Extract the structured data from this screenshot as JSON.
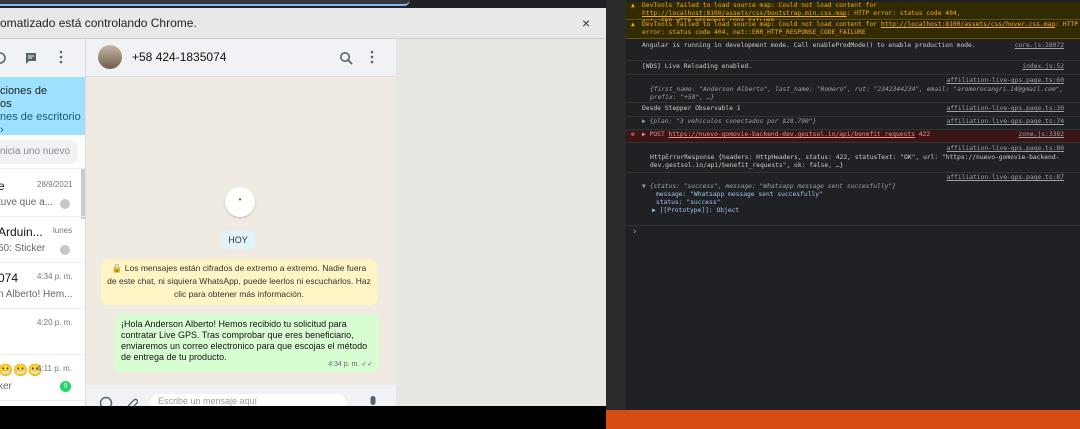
{
  "chrome": {
    "infobar_text": "omatizado está controlando Chrome.",
    "close_glyph": "×"
  },
  "sidebar": {
    "notification": {
      "line1": "ciones de",
      "line2": "os",
      "line3": "nes de escritorio ›"
    },
    "search_placeholder": "nicia uno nuevo",
    "chats": [
      {
        "name": "e",
        "preview": "tuve que a...",
        "time": "28/9/2021",
        "badge": ""
      },
      {
        "name": "Arduin...",
        "preview": "50: Sticker",
        "time": "lunes",
        "badge": ""
      },
      {
        "name": "074",
        "preview": "n Alberto! Hem...",
        "time": "4:34 p. m.",
        "badge": ""
      },
      {
        "name": "",
        "preview": "",
        "time": "4:20 p. m.",
        "badge": ""
      },
      {
        "name": "😬😬😬",
        "preview": "ker",
        "time": "4:11 p. m.",
        "badge": "9"
      }
    ]
  },
  "chat": {
    "contact": "+58 424-1835074",
    "day_label": "HOY",
    "encryption_notice": "🔒 Los mensajes están cifrados de extremo a extremo. Nadie fuera de este chat, ni siquiera WhatsApp, puede leerlos ni escucharlos. Haz clic para obtener más información.",
    "message_text": "¡Hola Anderson Alberto! Hemos recibido tu solicitud para contratar Live GPS. Tras comprobar que eres beneficiario, enviaremos un correo electronico para que escojas el método de entrega de tu producto.",
    "message_time": "4:34 p. m. ✓✓",
    "composer_placeholder": "Escribe un mensaje aquí"
  },
  "devtools": {
    "warn1": "DevTools failed to load source map: Could not load content for ",
    "warn1_link": "http://localhost:8100/assets/css/bootstrap.min.css.map",
    "warn1_tail": ": HTTP error: status code 404, net::ERR_HTTP_RESPONSE_CODE_FAILURE",
    "warn2": "DevTools failed to load source map: Could not load content for ",
    "warn2_link": "http://localhost:8100/assets/css/hover.css.map",
    "warn2_tail": ": HTTP error: status code 404, net::ERR_HTTP_RESPONSE_CODE_FAILURE",
    "angular": "Angular is running in development mode. Call enableProdMode() to enable production mode.",
    "angular_src": "core.js:28072",
    "wds": "[WDS] Live Reloading enabled.",
    "wds_src": "index.js:52",
    "user_src": "affiliation-live-gps.page.ts:60",
    "user_obj": "{first_name: \"Anderson Alberto\", last_name: \"Romero\", rut: \"2342344234\", email: \"aromerocangri.14@gmail.com\", prefix: \"+58\", …}",
    "stepper": "Desde Stepper Observable 1",
    "stepper_src": "affiliation-live-gps.page.ts:30",
    "plan_obj": "▶ {plan: \"3 vehiculos conectados por $28.790\"}",
    "plan_src": "affiliation-live-gps.page.ts:74",
    "post_prefix": "▶ POST ",
    "post_url": "https://nuevo-gomovie-backend-dev.gestsol.io/api/benefit_requests",
    "post_code": "422",
    "post_src": "zone.js:3382",
    "http_src": "affiliation-live-gps.page.ts:80",
    "http_obj": "HttpErrorResponse {headers: HttpHeaders, status: 422, statusText: \"OK\", url: \"https://nuevo-gomovie-backend-dev.gestsol.io/api/benefit_requests\", ok: false, …}",
    "success_src": "affiliation-live-gps.page.ts:87",
    "success_obj": "▼ {status: \"success\", message: \"Whatsapp message sent succesfully\"}",
    "success_message": "message: \"Whatsapp message sent succesfully\"",
    "success_status": "status: \"success\"",
    "success_proto": "▶ [[Prototype]]: Object",
    "prompt": "›"
  }
}
